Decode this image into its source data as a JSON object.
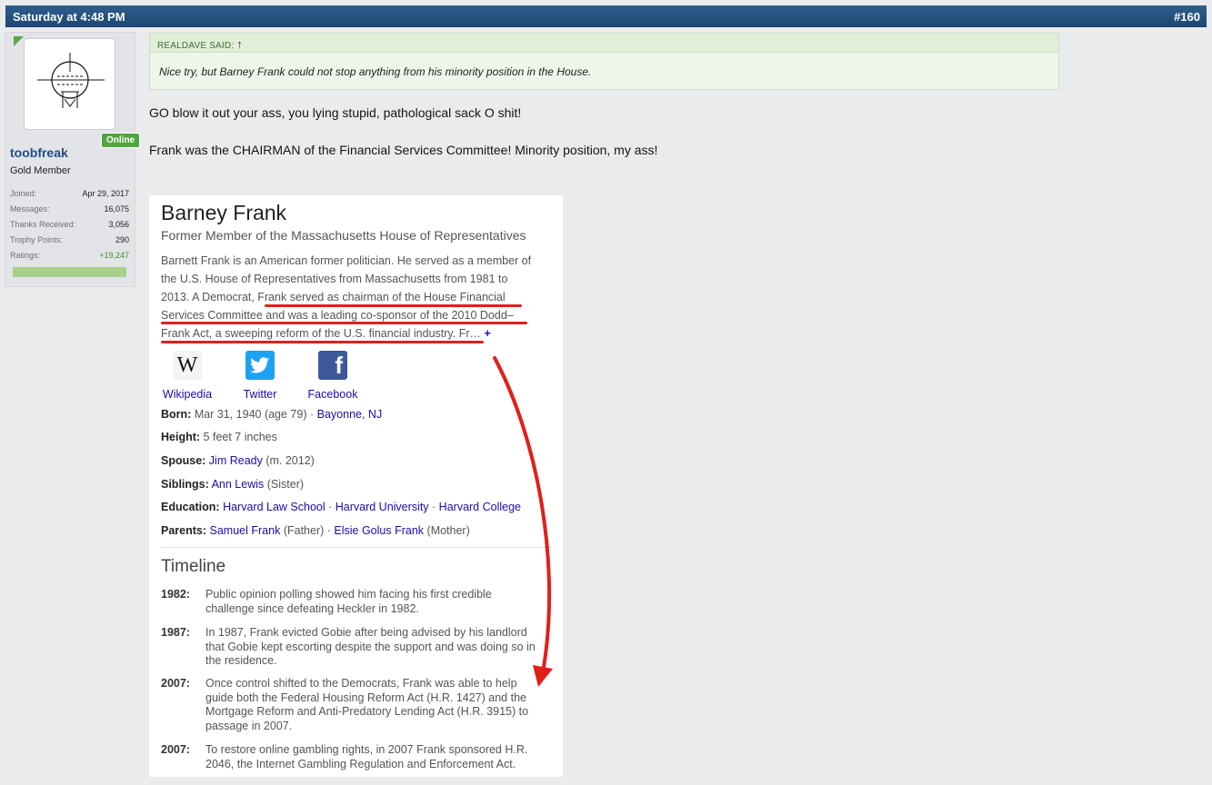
{
  "post": {
    "date": "Saturday at 4:48 PM",
    "number": "#160"
  },
  "user": {
    "online_badge": "Online",
    "name": "toobfreak",
    "title": "Gold Member",
    "stats": [
      {
        "label": "Joined:",
        "value": "Apr 29, 2017"
      },
      {
        "label": "Messages:",
        "value": "16,075"
      },
      {
        "label": "Thanks Received:",
        "value": "3,056"
      },
      {
        "label": "Trophy Points:",
        "value": "290"
      },
      {
        "label": "Ratings:",
        "value": "+19,247"
      }
    ],
    "rating_color": "#a8d08a"
  },
  "quote": {
    "author": "REALDAVE SAID:",
    "jump_icon": "up-arrow-icon",
    "text": "Nice try, but Barney Frank could not stop anything from his minority position in the House."
  },
  "message": {
    "line1": "GO blow it out your ass, you lying stupid, pathological sack O shit!",
    "line2": "Frank was the CHAIRMAN of the Financial Services Committee! Minority position, my ass!"
  },
  "card": {
    "name": "Barney Frank",
    "subtitle": "Former Member of the Massachusetts House of Representatives",
    "desc_lines": [
      "Barnett Frank is an American former politician. He served as a member of",
      "the U.S. House of Representatives from Massachusetts from 1981 to",
      "2013. A Democrat, Frank served as chairman of the House Financial",
      "Services Committee and was a leading co-sponsor of the 2010 Dodd–",
      "Frank Act, a sweeping reform of the U.S. financial industry. Fr…"
    ],
    "more": "+",
    "social": [
      {
        "label": "Wikipedia",
        "icon": "wikipedia-icon"
      },
      {
        "label": "Twitter",
        "icon": "twitter-icon"
      },
      {
        "label": "Facebook",
        "icon": "facebook-icon"
      }
    ],
    "facts": {
      "born_label": "Born:",
      "born_value": "Mar 31, 1940 (age 79) ·",
      "born_place": "Bayonne, NJ",
      "height_label": "Height:",
      "height_value": "5 feet 7 inches",
      "spouse_label": "Spouse:",
      "spouse_name": "Jim Ready",
      "spouse_extra": "(m. 2012)",
      "siblings_label": "Siblings:",
      "siblings_name": "Ann Lewis",
      "siblings_extra": "(Sister)",
      "education_label": "Education:",
      "education": [
        "Harvard Law School",
        "Harvard University",
        "Harvard College"
      ],
      "parents_label": "Parents:",
      "parent1": "Samuel Frank",
      "parent1_rel": "(Father) ·",
      "parent2": "Elsie Golus Frank",
      "parent2_rel": "(Mother)"
    },
    "timeline_title": "Timeline",
    "timeline": [
      {
        "year": "1982:",
        "lines": [
          "Public opinion polling showed him facing his first credible",
          "challenge since defeating Heckler in 1982."
        ]
      },
      {
        "year": "1987:",
        "lines": [
          "In 1987, Frank evicted Gobie after being advised by his landlord",
          "that Gobie kept escorting despite the support and was doing so in",
          "the residence."
        ]
      },
      {
        "year": "2007:",
        "lines": [
          "Once control shifted to the Democrats, Frank was able to help",
          "guide both the Federal Housing Reform Act (H.R. 1427) and the",
          "Mortgage Reform and Anti-Predatory Lending Act (H.R. 3915) to",
          "passage in 2007."
        ]
      },
      {
        "year": "2007:",
        "lines": [
          "To restore online gambling rights, in 2007 Frank sponsored H.R.",
          "2046, the Internet Gambling Regulation and Enforcement Act."
        ]
      }
    ]
  },
  "colors": {
    "header": "#1d4671",
    "link": "#1a0dab",
    "annotation_red": "#e21f1b",
    "online_green": "#4fa63d"
  }
}
